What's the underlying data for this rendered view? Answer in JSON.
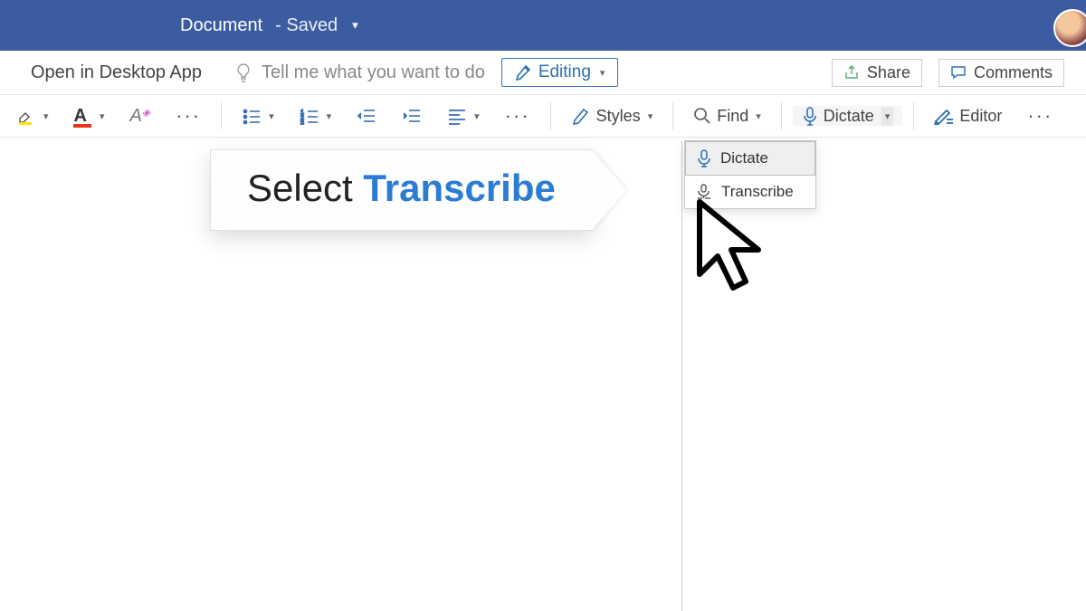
{
  "titlebar": {
    "doc_name": "Document",
    "saved_label": "- Saved"
  },
  "secrow": {
    "open_desktop": "Open in Desktop App",
    "tell_me_placeholder": "Tell me what you want to do",
    "editing_label": "Editing",
    "share_label": "Share",
    "comments_label": "Comments"
  },
  "ribbon": {
    "styles": "Styles",
    "find": "Find",
    "dictate": "Dictate",
    "editor": "Editor"
  },
  "dictate_menu": {
    "item1": "Dictate",
    "item2": "Transcribe"
  },
  "callout": {
    "prefix": "Select ",
    "highlight": "Transcribe"
  }
}
